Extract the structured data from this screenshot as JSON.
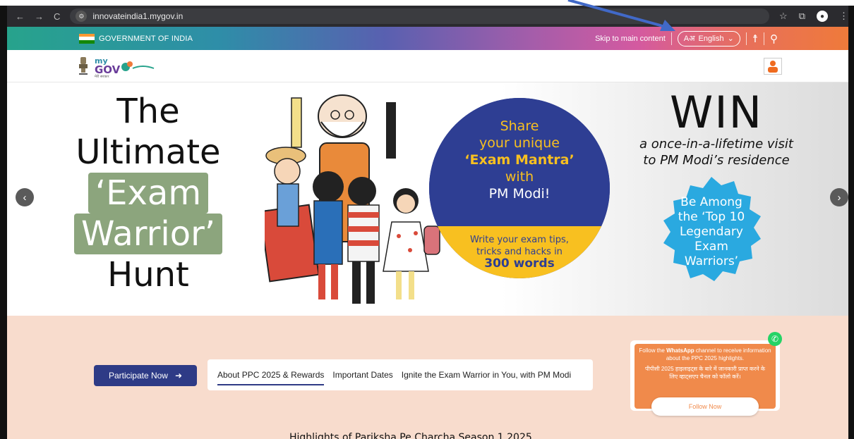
{
  "browser": {
    "url": "innovateindia1.mygov.in",
    "nav_back": "←",
    "nav_forward": "→",
    "nav_reload": "C",
    "site_icon": "⚙",
    "tool_star": "☆",
    "tool_ext": "⧉",
    "tool_menu": "⋮"
  },
  "gov_bar": {
    "label": "GOVERNMENT OF INDIA",
    "skip": "Skip to main content",
    "lang_glyph": "Aअ",
    "lang": "English",
    "lang_caret": "⌄",
    "access_icon": "☨",
    "user_plus_icon": "⚲"
  },
  "header": {
    "emblem_icon": "emblem-icon",
    "logo": "mygov-logo"
  },
  "banner": {
    "hero_lines": [
      "The",
      "Ultimate",
      "‘Exam",
      "Warrior’",
      "Hunt"
    ],
    "mantra": {
      "line1": "Share",
      "line2": "your unique",
      "line3": "‘Exam Mantra’",
      "line4": "with",
      "line5": "PM Modi!"
    },
    "write": {
      "line1": "Write your exam tips,",
      "line2": "tricks and hacks in",
      "line3": "300 words"
    },
    "win": {
      "title": "WIN",
      "sub1": "a once-in-a-lifetime visit",
      "sub2": "to PM Modi’s residence"
    },
    "seal": {
      "line1": "Be Among",
      "line2": "the ‘Top 10",
      "line3": "Legendary",
      "line4": "Exam",
      "line5": "Warriors’"
    },
    "arrow_left": "‹",
    "arrow_right": "›"
  },
  "lower": {
    "participate": "Participate Now",
    "participate_arrow": "➜",
    "tabs": [
      "About PPC 2025 & Rewards",
      "Important Dates",
      "Ignite the Exam Warrior in You, with PM Modi"
    ],
    "whatsapp": {
      "en_pre": "Follow the ",
      "en_bold": "WhatsApp",
      "en_post": " channel to receive information about the PPC 2025 highlights.",
      "hi": "पीपीसी 2025 हाइलाइट्स के बारे में जानकारी प्राप्त करने के लिए व्हाट्सएप चैनल को फॉलो करें।",
      "follow": "Follow Now",
      "icon": "✆"
    },
    "bottom_heading": "Highlights of Pariksha Pe Charcha Season 1 2025"
  },
  "colors": {
    "navy": "#2e3b86",
    "sage": "#8ca57d",
    "peach": "#f8dccd",
    "orange": "#f08a4b",
    "whatsapp": "#25d366",
    "mantra_blue": "#2e3e93",
    "mantra_yellow": "#f8c020",
    "seal_blue": "#2aa9e0"
  }
}
